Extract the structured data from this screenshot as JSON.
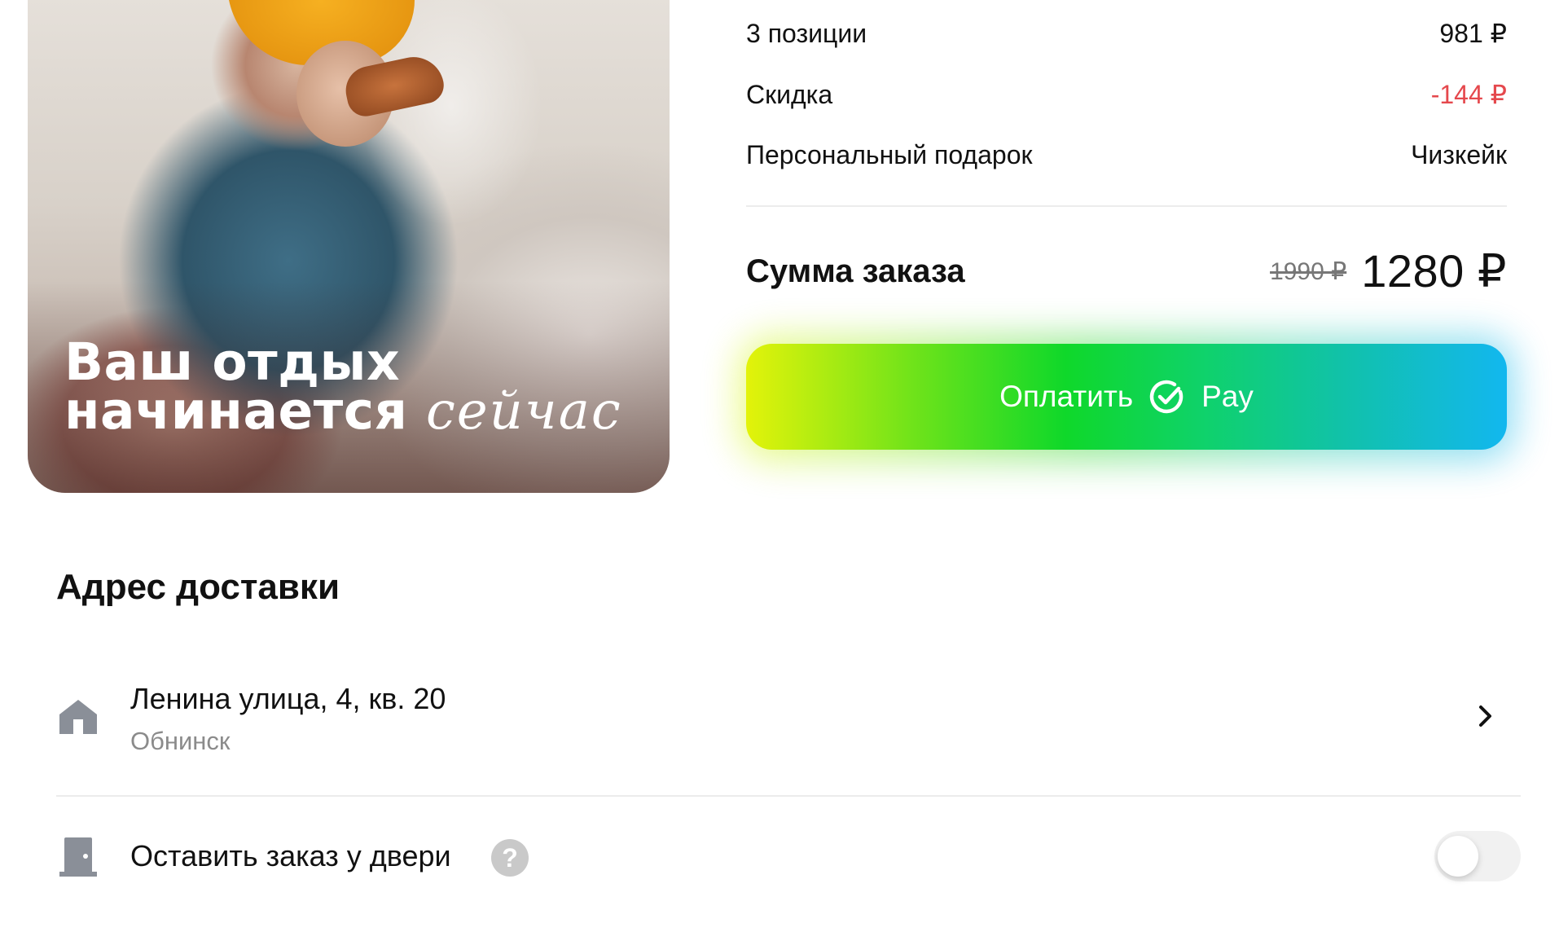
{
  "promo": {
    "headline_line1": "Ваш отдых",
    "headline_line2": "начинается",
    "headline_accent": "сейчас"
  },
  "summary": {
    "rows": [
      {
        "label": "3 позиции",
        "value": "981 ₽"
      },
      {
        "label": "Скидка",
        "value": "-144 ₽"
      },
      {
        "label": "Персональный подарок",
        "value": "Чизкейк"
      }
    ],
    "total_label": "Сумма заказа",
    "old_price": "1990 ₽",
    "new_price": "1280 ₽",
    "discount_color": "#e5484d"
  },
  "pay_button": {
    "label": "Оплатить",
    "pay_text": "Pay",
    "icon": "check-circle-icon"
  },
  "delivery": {
    "title": "Адрес доставки",
    "address_line": "Ленина улица, 4, кв. 20",
    "city": "Обнинск",
    "leave_at_door_label": "Оставить заказ у двери",
    "help_glyph": "?",
    "leave_at_door_enabled": false
  }
}
